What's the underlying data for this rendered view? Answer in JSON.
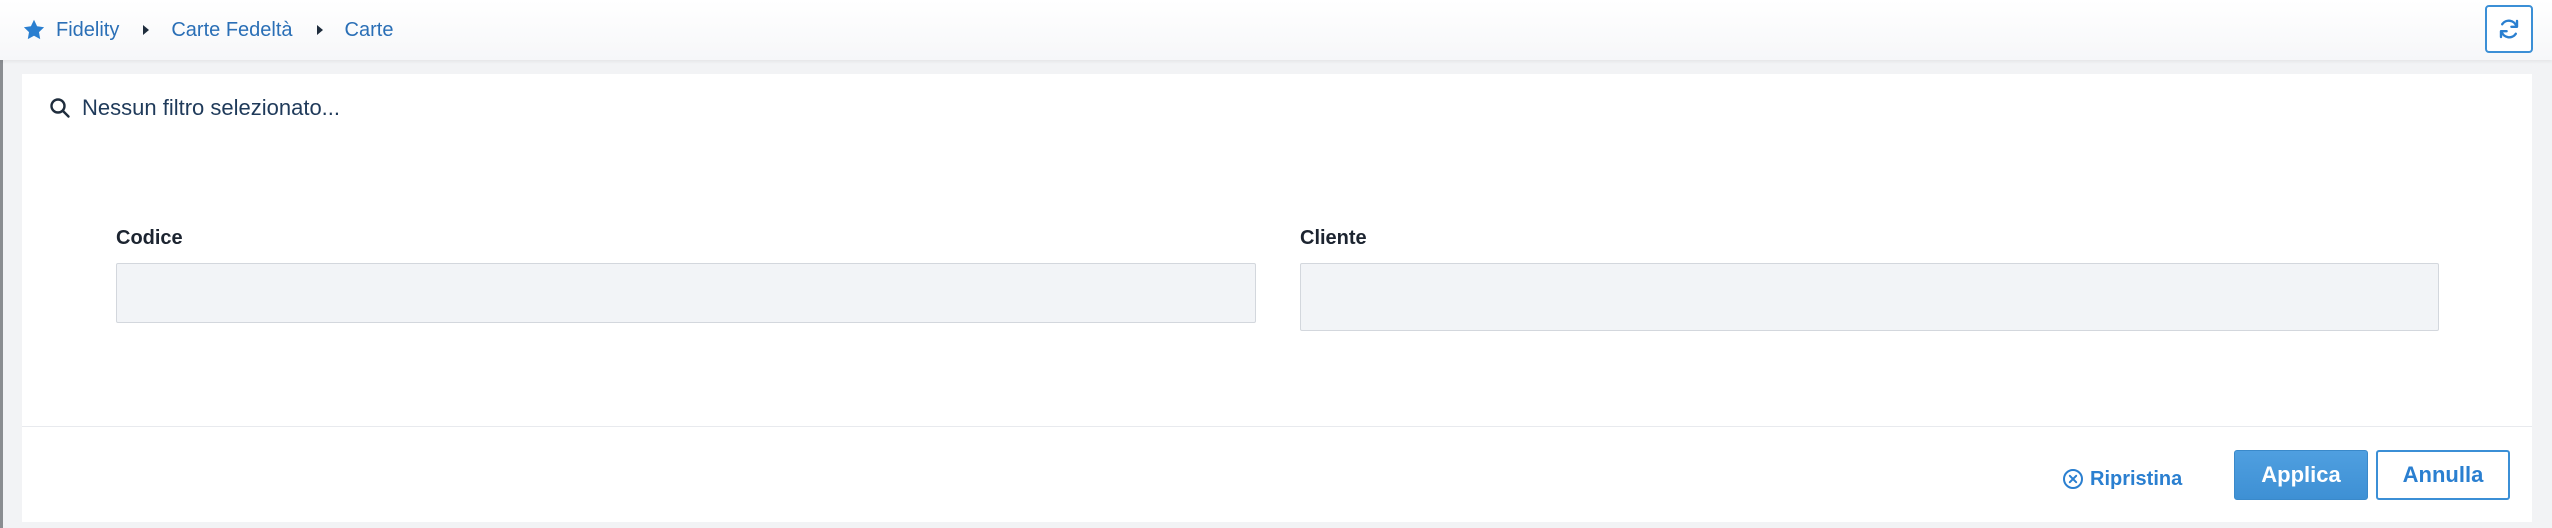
{
  "breadcrumb": {
    "icon": "star-icon",
    "items": [
      {
        "label": "Fidelity"
      },
      {
        "label": "Carte Fedeltà"
      },
      {
        "label": "Carte"
      }
    ]
  },
  "toolbar": {
    "refresh_icon": "refresh-icon"
  },
  "filter": {
    "summary_icon": "search-icon",
    "summary_text": "Nessun filtro selezionato...",
    "fields": [
      {
        "label": "Codice",
        "value": "",
        "placeholder": ""
      },
      {
        "label": "Cliente",
        "value": "",
        "placeholder": ""
      }
    ]
  },
  "actions": {
    "reset_icon": "circle-x-icon",
    "reset_label": "Ripristina",
    "apply_label": "Applica",
    "cancel_label": "Annulla"
  },
  "colors": {
    "accent": "#2a7fd0",
    "breadcrumb_link": "#2a6fb6",
    "apply_bg": "#4599da",
    "input_bg": "#f2f4f7"
  }
}
